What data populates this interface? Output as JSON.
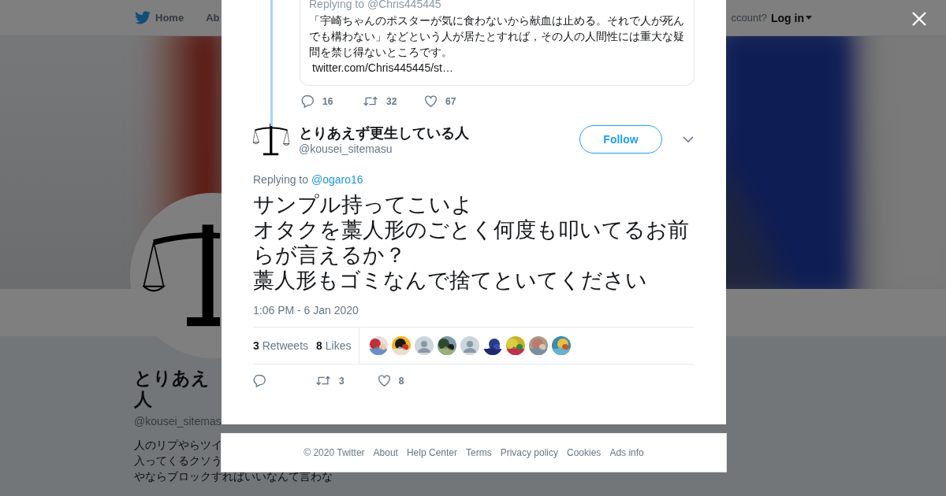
{
  "nav": {
    "items": [
      {
        "label": "Home",
        "kind": "home"
      },
      {
        "label": "Ab",
        "kind": "plain"
      }
    ],
    "account_prompt": "ccount?",
    "login": "Log in"
  },
  "profile": {
    "name_lines": [
      "とりあえ",
      "人"
    ],
    "handle": "@kousei_sitemas",
    "bio_lines": [
      "人のリプやらツイ",
      "入ってくるクソう",
      "やならブロックすればいいなんて言わな"
    ]
  },
  "quoted": {
    "replying_label": "Replying to",
    "replying_to": "@Chris445445",
    "text": "「宇崎ちゃんのポスターが気に食わないから献血は止める。それで人が死んでも構わない」などという人が居たとすれば，その人の人間性には重大な疑問を禁じ得ないところです。",
    "link": "twitter.com/Chris445445/st…",
    "replies": "16",
    "retweets": "32",
    "likes": "67"
  },
  "tweet": {
    "name": "とりあえず更生している人",
    "handle": "@kousei_sitemasu",
    "follow": "Follow",
    "replying_label": "Replying to",
    "replying_to": "@ogaro16",
    "text_lines": [
      "サンプル持ってこいよ",
      "オタクを藁人形のごとく何度も叩いてるお前らが言えるか？",
      "藁人形もゴミなんで捨てといてください"
    ],
    "time": "1:06 PM - 6 Jan 2020",
    "retweet_count": "3",
    "retweet_label": "Retweets",
    "like_count": "8",
    "like_label": "Likes",
    "likers": [
      {
        "kind": "picture"
      },
      {
        "kind": "picture"
      },
      {
        "kind": "default"
      },
      {
        "kind": "picture"
      },
      {
        "kind": "default"
      },
      {
        "kind": "picture"
      },
      {
        "kind": "picture"
      },
      {
        "kind": "picture"
      },
      {
        "kind": "picture"
      }
    ],
    "retweets": "3",
    "likes": "8"
  },
  "footer": {
    "links": [
      "© 2020 Twitter",
      "About",
      "Help Center",
      "Terms",
      "Privacy policy",
      "Cookies",
      "Ads info"
    ]
  }
}
